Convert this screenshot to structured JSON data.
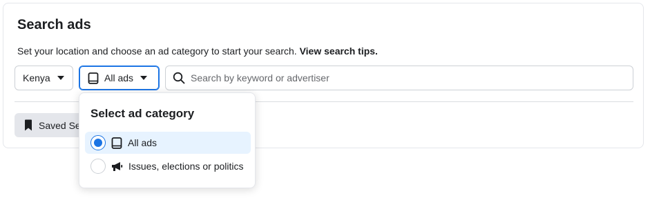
{
  "page": {
    "title": "Search ads",
    "subtitle_text": "Set your location and choose an ad category to start your search. ",
    "subtitle_link": "View search tips."
  },
  "filters": {
    "country": "Kenya",
    "category": "All ads",
    "search_placeholder": "Search by keyword or advertiser"
  },
  "saved_button": {
    "label": "Saved Se"
  },
  "dropdown": {
    "title": "Select ad category",
    "options": [
      {
        "label": "All ads",
        "icon": "tablet-icon",
        "selected": true
      },
      {
        "label": "Issues, elections or politics",
        "icon": "megaphone-icon",
        "selected": false
      }
    ]
  },
  "colors": {
    "accent": "#1b74e4",
    "selected_bg": "#e7f3ff",
    "border": "#ccd0d5"
  }
}
